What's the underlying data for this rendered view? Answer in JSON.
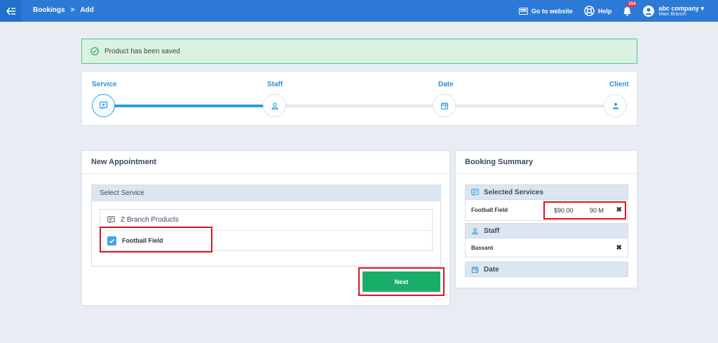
{
  "breadcrumb": {
    "root": "Bookings",
    "separator": ">",
    "current": "Add"
  },
  "topbar": {
    "website_label": "Go to website",
    "help_label": "Help",
    "notif_count": "154",
    "user_name": "abc company",
    "user_branch": "Main Branch"
  },
  "alert": {
    "message": "Product has been saved"
  },
  "steps": [
    {
      "label": "Service",
      "icon": "service-icon"
    },
    {
      "label": "Staff",
      "icon": "staff-icon"
    },
    {
      "label": "Date",
      "icon": "date-icon"
    },
    {
      "label": "Client",
      "icon": "client-icon"
    }
  ],
  "appointment": {
    "title": "New Appointment",
    "select_title": "Select Service",
    "category": "Z Branch Products",
    "service": "Football Field",
    "next_label": "Next"
  },
  "summary": {
    "title": "Booking Summary",
    "services_title": "Selected Services",
    "service_name": "Football Field",
    "price": "$90.00",
    "duration": "90 M",
    "staff_title": "Staff",
    "staff_name": "Bassant",
    "date_title": "Date"
  },
  "colors": {
    "brand": "#2c7ad6",
    "accent": "#2aa0e0",
    "success": "#19ad6a",
    "highlight": "#e0151e"
  }
}
